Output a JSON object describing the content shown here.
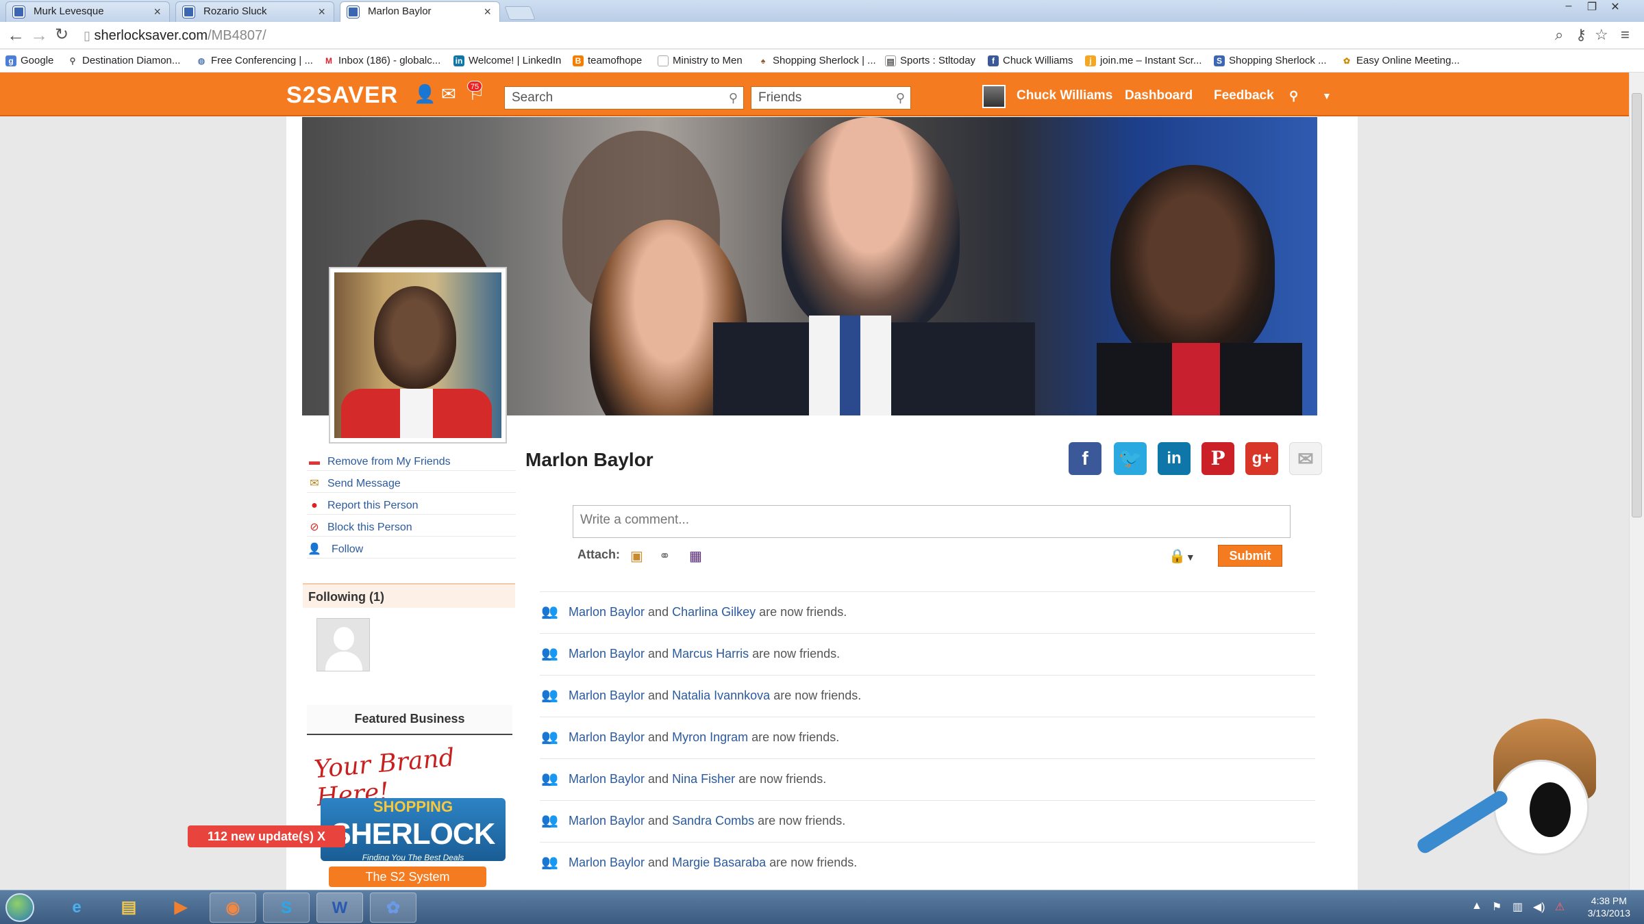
{
  "browser": {
    "tabs": [
      {
        "label": "Murk Levesque"
      },
      {
        "label": "Rozario Sluck"
      },
      {
        "label": "Marlon Baylor"
      }
    ],
    "url_host": "sherlocksaver.com",
    "url_path": "/MB4807/",
    "bookmarks": [
      "Google",
      "Destination Diamon...",
      "Free Conferencing | ...",
      "Inbox (186) - globalc...",
      "Welcome! | LinkedIn",
      "teamofhope",
      "Ministry to Men",
      "Shopping Sherlock | ...",
      "Sports : Stltoday",
      "Chuck Williams",
      "join.me – Instant Scr...",
      "Shopping Sherlock ...",
      "Easy Online Meeting..."
    ]
  },
  "header": {
    "logo": "S2SAVER",
    "notification_count": "75",
    "search_placeholder": "Search",
    "friends_placeholder": "Friends",
    "user_name": "Chuck Williams",
    "dashboard": "Dashboard",
    "feedback": "Feedback"
  },
  "sidebar": {
    "actions": [
      "Remove from My Friends",
      "Send Message",
      "Report this Person",
      "Block this Person",
      "Follow"
    ],
    "following_title": "Following (1)",
    "featured_title": "Featured Business",
    "ad": {
      "brand": "Your Brand Here!",
      "logo_top": "SHOPPING",
      "logo_big": "SHERLOCK",
      "logo_sub": "Finding You The Best Deals",
      "button": "The S2 System"
    },
    "updates": "112 new update(s) X"
  },
  "profile": {
    "name": "Marlon Baylor",
    "comment_placeholder": "Write a comment...",
    "attach_label": "Attach:",
    "submit": "Submit"
  },
  "feed": [
    {
      "a": "Marlon Baylor",
      "b": "Charlina Gilkey",
      "text": " are now friends."
    },
    {
      "a": "Marlon Baylor",
      "b": "Marcus Harris",
      "text": " are now friends."
    },
    {
      "a": "Marlon Baylor",
      "b": "Natalia Ivannkova",
      "text": " are now friends."
    },
    {
      "a": "Marlon Baylor",
      "b": "Myron Ingram",
      "text": " are now friends."
    },
    {
      "a": "Marlon Baylor",
      "b": "Nina Fisher",
      "text": " are now friends."
    },
    {
      "a": "Marlon Baylor",
      "b": "Sandra Combs",
      "text": " are now friends."
    },
    {
      "a": "Marlon Baylor",
      "b": "Margie Basaraba",
      "text": " are now friends."
    }
  ],
  "feed_joiner": " and ",
  "taskbar": {
    "time": "4:38 PM",
    "date": "3/13/2013"
  },
  "colors": {
    "brand_orange": "#f47b20",
    "link_blue": "#2b5a9e"
  }
}
